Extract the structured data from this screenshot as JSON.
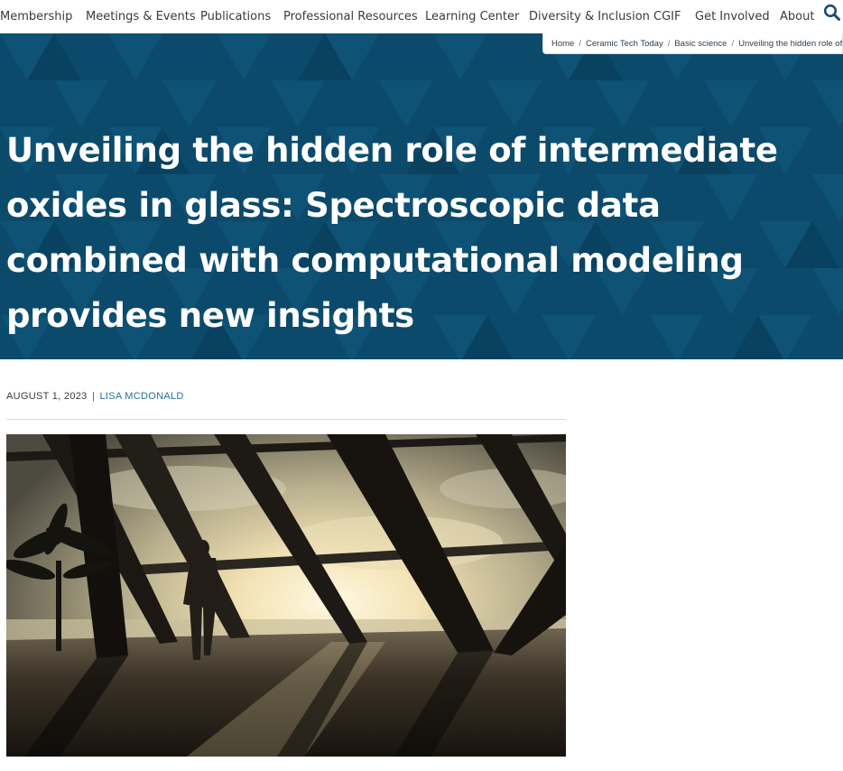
{
  "nav": {
    "items": [
      {
        "label": "Membership"
      },
      {
        "label": "Meetings & Events"
      },
      {
        "label": "Publications"
      },
      {
        "label": "Professional Resources"
      },
      {
        "label": "Learning Center"
      },
      {
        "label": "Diversity & Inclusion"
      },
      {
        "label": "CGIF"
      },
      {
        "label": "Get Involved"
      },
      {
        "label": "About"
      }
    ],
    "search_icon": "search-icon"
  },
  "breadcrumb": {
    "items": [
      "Home",
      "Ceramic Tech Today",
      "Basic science",
      "Unveiling the hidden role of in"
    ],
    "separator": "/"
  },
  "article": {
    "title_lines": [
      "Unveiling the hidden role of intermediate",
      "oxides in glass: Spectroscopic data",
      "combined with computational modeling",
      "provides new insights"
    ],
    "date": "AUGUST 1, 2023",
    "meta_separator": "|",
    "author": "LISA MCDONALD"
  },
  "colors": {
    "hero_bg": "#0c4a6b",
    "author_link": "#2a6f97",
    "search_icon": "#1d4f73"
  }
}
